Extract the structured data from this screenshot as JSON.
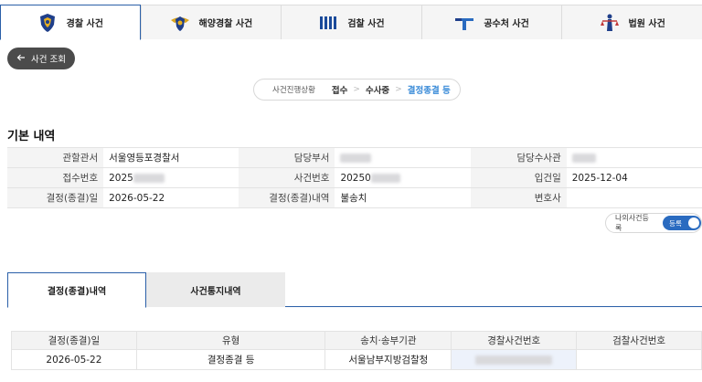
{
  "agency_tabs": [
    {
      "label": "경찰 사건",
      "icon": "police-badge-icon"
    },
    {
      "label": "해양경찰 사건",
      "icon": "coast-guard-badge-icon"
    },
    {
      "label": "검찰 사건",
      "icon": "prosecution-logo-icon"
    },
    {
      "label": "공수처 사건",
      "icon": "cio-logo-icon"
    },
    {
      "label": "법원 사건",
      "icon": "court-justice-icon"
    }
  ],
  "back_button": {
    "label": "사건 조회",
    "icon": "arrow-left-icon"
  },
  "progress": {
    "title": "사건진행상황",
    "steps": [
      "접수",
      "수사중",
      "결정종결 등"
    ],
    "separator": ">"
  },
  "basic_info": {
    "title": "기본 내역",
    "rows": [
      [
        {
          "label": "관할관서",
          "value": "서울영등포경찰서"
        },
        {
          "label": "담당부서",
          "value": ""
        },
        {
          "label": "담당수사관",
          "value": ""
        }
      ],
      [
        {
          "label": "접수번호",
          "value": "2025"
        },
        {
          "label": "사건번호",
          "value": "20250"
        },
        {
          "label": "입건일",
          "value": "2025-12-04"
        }
      ],
      [
        {
          "label": "결정(종결)일",
          "value": "2026-05-22"
        },
        {
          "label": "결정(종결)내역",
          "value": "불송치"
        },
        {
          "label": "변호사",
          "value": ""
        }
      ]
    ]
  },
  "my_case": {
    "label": "나의사건등록",
    "toggle_label": "등록",
    "on": true
  },
  "sub_tabs": [
    "결정(종결)내역",
    "사건통지내역"
  ],
  "result_table": {
    "headers": [
      "결정(종결)일",
      "유형",
      "송치·송부기관",
      "경찰사건번호",
      "검찰사건번호"
    ],
    "rows": [
      [
        "2026-05-22",
        "결정종결 등",
        "서울남부지방검찰청",
        "",
        ""
      ]
    ]
  },
  "colors": {
    "accent": "#2a5fa8",
    "step_current": "#3a8bd8",
    "back_button": "#4b4b4b",
    "toggle": "#2a6bc0"
  }
}
